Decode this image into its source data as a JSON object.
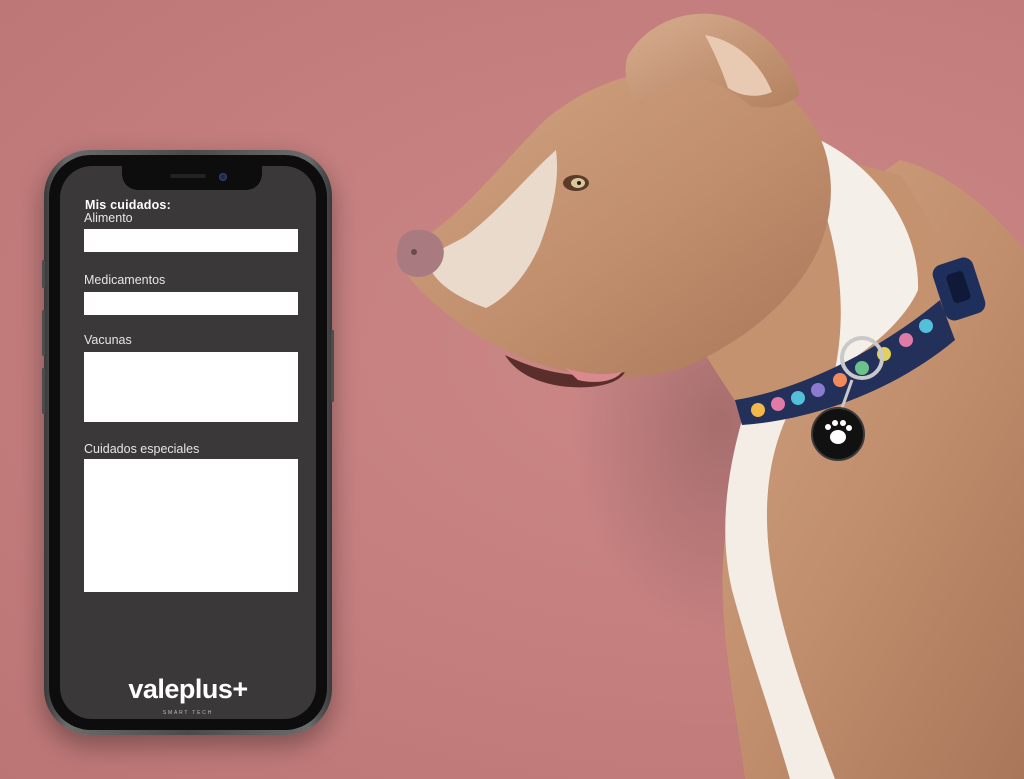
{
  "app": {
    "form_title": "Mis cuidados:",
    "fields": [
      {
        "label": "Alimento",
        "value": ""
      },
      {
        "label": "Medicamentos",
        "value": ""
      },
      {
        "label": "Vacunas",
        "value": ""
      },
      {
        "label": "Cuidados especiales",
        "value": ""
      }
    ],
    "brand": {
      "name": "valeplus+",
      "tagline": "SMART TECH"
    }
  },
  "colors": {
    "background": "#c47f7f",
    "screen": "#3a3838",
    "field": "#ffffff",
    "collar_band": "#23305a",
    "tag": "#111111"
  },
  "icons": {
    "tag": "paw-icon"
  }
}
